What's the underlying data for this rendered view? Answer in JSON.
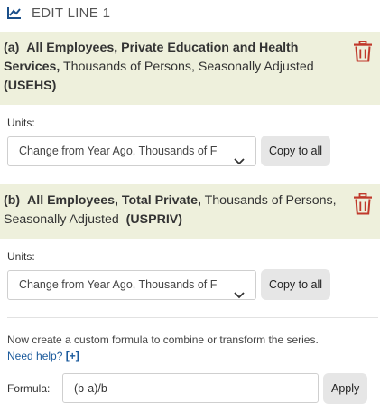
{
  "header": {
    "icon": "line-chart-icon",
    "title": "EDIT LINE 1"
  },
  "series": [
    {
      "letter": "(a)",
      "name": "All Employees, Private Education and Health Services,",
      "details": "Thousands of Persons, Seasonally Adjusted",
      "code": "(USEHS)",
      "units_label": "Units:",
      "units_value": "Change from Year Ago, Thousands of F",
      "copy_label": "Copy to all"
    },
    {
      "letter": "(b)",
      "name": "All Employees, Total Private,",
      "details": "Thousands of Persons, Seasonally Adjusted",
      "code": "(USPRIV)",
      "units_label": "Units:",
      "units_value": "Change from Year Ago, Thousands of F",
      "copy_label": "Copy to all"
    }
  ],
  "formula": {
    "hint": "Now create a custom formula to combine or transform the series.",
    "help_label": "Need help?",
    "help_plus": "[+]",
    "label": "Formula:",
    "value": "(b-a)/b",
    "apply_label": "Apply"
  },
  "colors": {
    "panel_bg": "#eef0dc",
    "trash_red": "#c0392b",
    "link_blue": "#1a5a9c",
    "header_icon": "#1a4f8a"
  }
}
